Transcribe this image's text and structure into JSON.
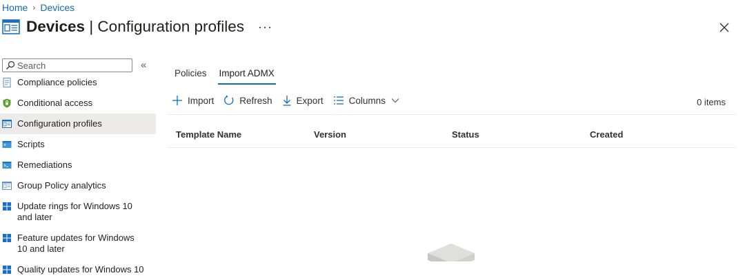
{
  "breadcrumb": {
    "home": "Home",
    "separator": "›",
    "current": "Devices"
  },
  "header": {
    "title_bold": "Devices",
    "title_rest": " | Configuration profiles",
    "more": "···",
    "icon": "configuration-profile-icon",
    "close_icon": "close-icon"
  },
  "sidebar": {
    "search_placeholder": "Search",
    "collapse_glyph": "«",
    "items": [
      {
        "label": "Compliance policies",
        "icon": "compliance-icon"
      },
      {
        "label": "Conditional access",
        "icon": "shield-icon"
      },
      {
        "label": "Configuration profiles",
        "icon": "configuration-profile-icon",
        "active": true
      },
      {
        "label": "Scripts",
        "icon": "script-icon"
      },
      {
        "label": "Remediations",
        "icon": "remediation-icon"
      },
      {
        "label": "Group Policy analytics",
        "icon": "group-policy-icon"
      },
      {
        "label": "Update rings for Windows 10 and later",
        "icon": "windows-icon"
      },
      {
        "label": "Feature updates for Windows 10 and later",
        "icon": "windows-icon"
      },
      {
        "label": "Quality updates for Windows 10",
        "icon": "windows-icon"
      }
    ]
  },
  "tabs": [
    {
      "label": "Policies"
    },
    {
      "label": "Import ADMX",
      "active": true
    }
  ],
  "toolbar": {
    "import": "Import",
    "refresh": "Refresh",
    "export": "Export",
    "columns": "Columns",
    "count": "0 items"
  },
  "table": {
    "columns": [
      "Template Name",
      "Version",
      "Status",
      "Created"
    ]
  },
  "colors": {
    "accent": "#0f6cbd",
    "active_bg": "#edebe9"
  }
}
